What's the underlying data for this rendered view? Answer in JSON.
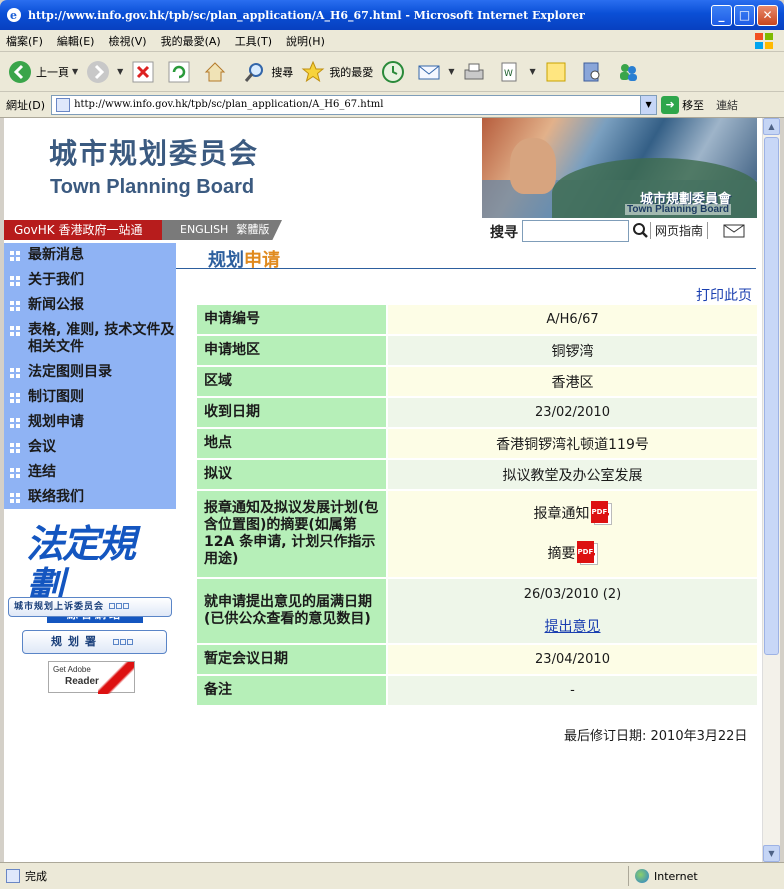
{
  "window": {
    "title": "http://www.info.gov.hk/tpb/sc/plan_application/A_H6_67.html - Microsoft Internet Explorer"
  },
  "menu": [
    "檔案(F)",
    "編輯(E)",
    "檢視(V)",
    "我的最愛(A)",
    "工具(T)",
    "說明(H)"
  ],
  "toolbar": {
    "back_label": "上一頁",
    "search_label": "搜尋",
    "favorites_label": "我的最愛"
  },
  "address": {
    "label": "網址(D)",
    "url": "http://www.info.gov.hk/tpb/sc/plan_application/A_H6_67.html",
    "go_label": "移至",
    "links_label": "連結"
  },
  "status": {
    "text": "完成",
    "zone": "Internet"
  },
  "header": {
    "title_zh": "城市规划委员会",
    "title_en": "Town Planning Board",
    "banner_zh": "城市規劃委員會",
    "banner_en": "Town Planning Board"
  },
  "nav": {
    "govhk": "GovHK 香港政府一站通",
    "english": "ENGLISH",
    "traditional": "繁體版",
    "search_label": "搜寻",
    "search_value": "",
    "sitemap": "网页指南"
  },
  "sidebar": {
    "items": [
      {
        "label": "最新消息"
      },
      {
        "label": "关于我们"
      },
      {
        "label": "新闻公报"
      },
      {
        "label": "表格, 准则, 技术文件及相关文件"
      },
      {
        "label": "法定图则目录"
      },
      {
        "label": "制订图则"
      },
      {
        "label": "规划申请"
      },
      {
        "label": "会议"
      },
      {
        "label": "连结"
      },
      {
        "label": "联络我们"
      }
    ],
    "ozp_big": "法定規劃",
    "ozp_sub": "綜合網站",
    "appeal": "城市规划上诉委员会",
    "pland": "规划署",
    "adobe_get": "Get Adobe",
    "adobe_reader": "Reader"
  },
  "main": {
    "title_a": "规划",
    "title_b": "申请",
    "print": "打印此页",
    "rows": [
      {
        "key": "申请编号",
        "value": "A/H6/67"
      },
      {
        "key": "申请地区",
        "value": "铜锣湾"
      },
      {
        "key": "区域",
        "value": "香港区"
      },
      {
        "key": "收到日期",
        "value": "23/02/2010"
      },
      {
        "key": "地点",
        "value": "香港铜锣湾礼顿道119号"
      },
      {
        "key": "拟议",
        "value": "拟议教堂及办公室发展"
      },
      {
        "key": "报章通知及拟议发展计划(包含位置图)的摘要(如属第 12A 条申请, 计划只作指示用途)",
        "doc1": "报章通知",
        "doc2": "摘要"
      },
      {
        "key": "就申请提出意见的届满日期 (已供公众查看的意见数目)",
        "value": "26/03/2010 (2)",
        "link": "提出意见"
      },
      {
        "key": "暂定会议日期",
        "value": "23/04/2010"
      },
      {
        "key": "备注",
        "value": "-"
      }
    ],
    "last_revised": "最后修订日期: 2010年3月22日"
  }
}
